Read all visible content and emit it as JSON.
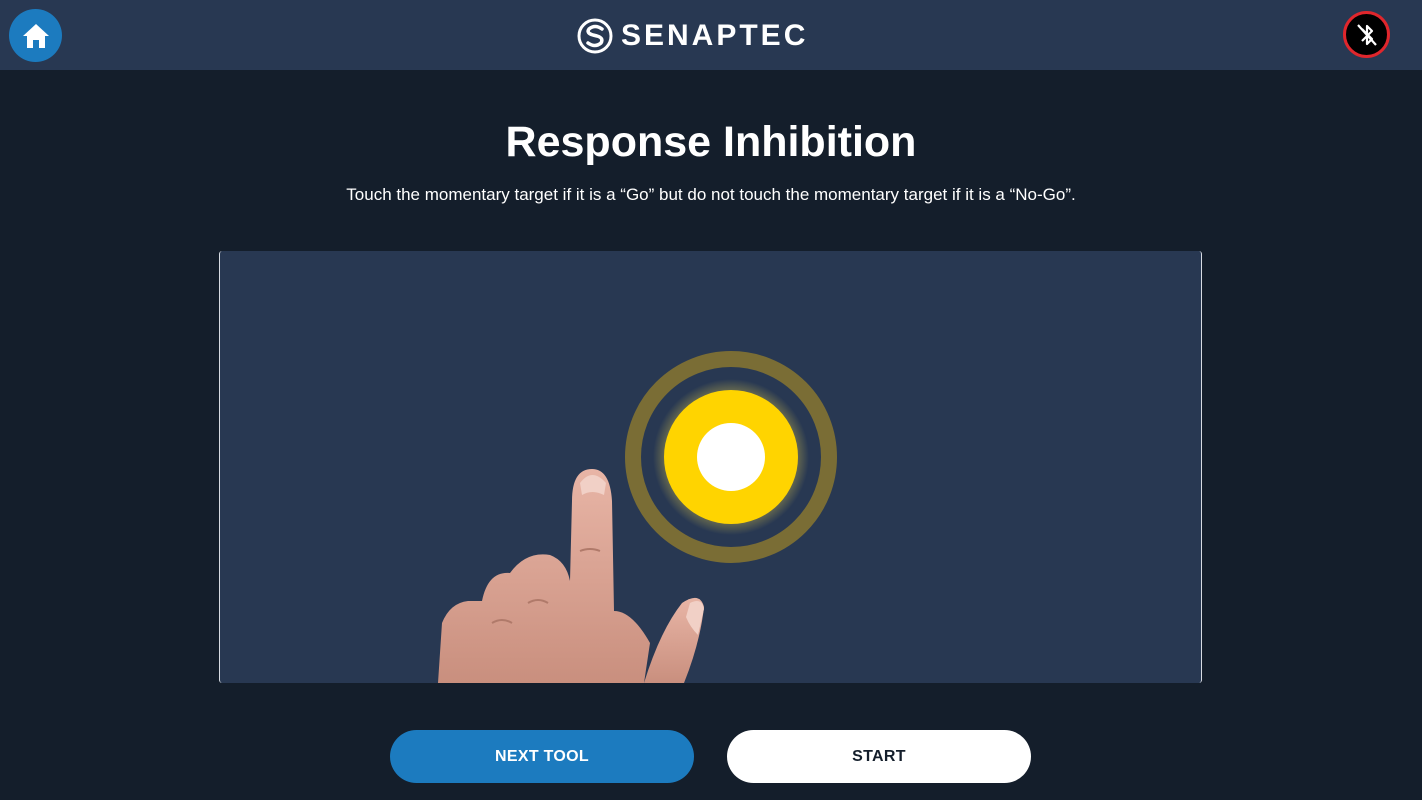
{
  "header": {
    "brand": "SENAPTEC",
    "home_icon": "home-icon",
    "bluetooth_icon": "bluetooth-disabled-icon",
    "colors": {
      "bar": "#283852",
      "home": "#1c7bbf",
      "bluetooth_ring": "#e0262c"
    }
  },
  "main": {
    "title": "Response Inhibition",
    "instructions": "Touch the momentary target if it is a “Go” but do not touch the momentary target if it is a “No-Go”.",
    "demo": {
      "target_colors": {
        "core": "#ffffff",
        "fill": "#ffd400",
        "ring": "#7a6d35"
      },
      "hand_icon": "pointing-hand-icon"
    }
  },
  "actions": {
    "next_tool_label": "NEXT TOOL",
    "start_label": "START"
  }
}
